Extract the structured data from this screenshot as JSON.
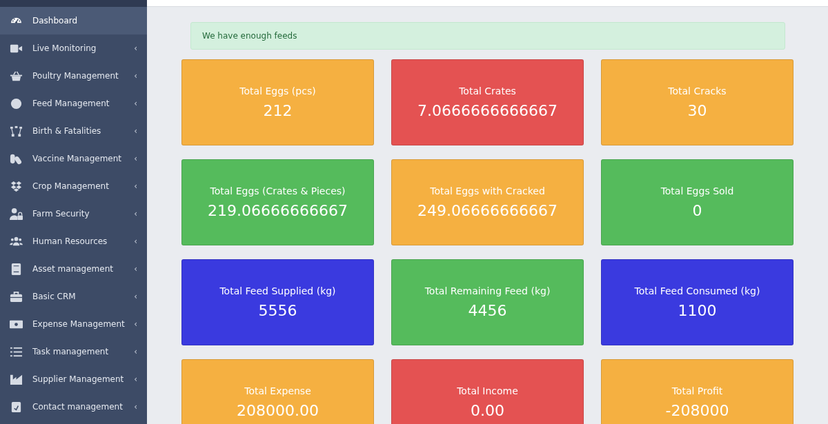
{
  "sidebar": {
    "items": [
      {
        "label": "Dashboard",
        "selected": true
      },
      {
        "label": "Live Monitoring",
        "selected": false,
        "caret": "‹"
      },
      {
        "label": "Poultry Management",
        "selected": false,
        "caret": "‹"
      },
      {
        "label": "Feed Management",
        "selected": false,
        "caret": "‹"
      },
      {
        "label": "Birth & Fatalities",
        "selected": false,
        "caret": "‹"
      },
      {
        "label": "Vaccine Management",
        "selected": false,
        "caret": "‹"
      },
      {
        "label": "Crop Management",
        "selected": false,
        "caret": "‹"
      },
      {
        "label": "Farm Security",
        "selected": false,
        "caret": "‹"
      },
      {
        "label": "Human Resources",
        "selected": false,
        "caret": "‹"
      },
      {
        "label": "Asset management",
        "selected": false,
        "caret": "‹"
      },
      {
        "label": "Basic CRM",
        "selected": false,
        "caret": "‹"
      },
      {
        "label": "Expense Management",
        "selected": false,
        "caret": "‹"
      },
      {
        "label": "Task management",
        "selected": false,
        "caret": "‹"
      },
      {
        "label": "Supplier Management",
        "selected": false,
        "caret": "‹"
      },
      {
        "label": "Contact management",
        "selected": false,
        "caret": "‹"
      }
    ]
  },
  "alert": {
    "text": "We have enough feeds"
  },
  "cards": [
    {
      "title": "Total Eggs (pcs)",
      "value": "212",
      "color": "#f5b041"
    },
    {
      "title": "Total Crates",
      "value": "7.0666666666667",
      "color": "#e45252"
    },
    {
      "title": "Total Cracks",
      "value": "30",
      "color": "#f5b041"
    },
    {
      "title": "Total Eggs (Crates & Pieces)",
      "value": "219.06666666667",
      "color": "#55bb5c"
    },
    {
      "title": "Total Eggs with Cracked",
      "value": "249.06666666667",
      "color": "#f5b041"
    },
    {
      "title": "Total Eggs Sold",
      "value": "0",
      "color": "#55bb5c"
    },
    {
      "title": "Total Feed Supplied (kg)",
      "value": "5556",
      "color": "#3a3adf"
    },
    {
      "title": "Total Remaining Feed (kg)",
      "value": "4456",
      "color": "#55bb5c"
    },
    {
      "title": "Total Feed Consumed (kg)",
      "value": "1100",
      "color": "#3a3adf"
    },
    {
      "title": "Total Expense",
      "value": "208000.00",
      "color": "#f5b041"
    },
    {
      "title": "Total Income",
      "value": "0.00",
      "color": "#e45252"
    },
    {
      "title": "Total Profit",
      "value": "-208000",
      "color": "#f5b041"
    }
  ]
}
